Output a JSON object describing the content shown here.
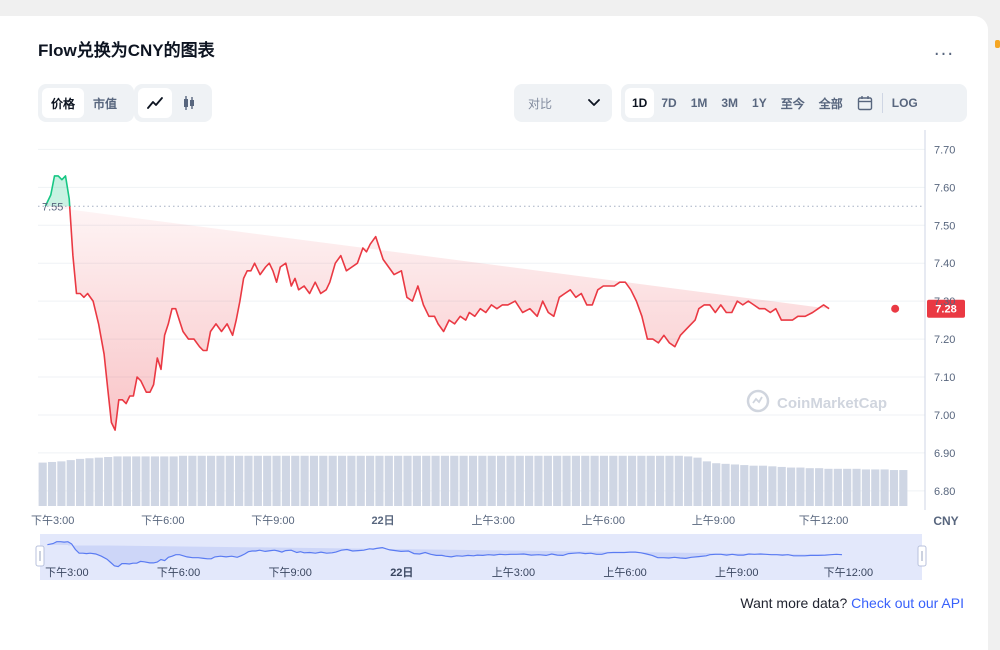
{
  "header": {
    "title": "Flow兑换为CNY的图表",
    "more_label": "..."
  },
  "type_toggle": [
    {
      "label": "价格",
      "active": true
    },
    {
      "label": "市值",
      "active": false
    }
  ],
  "style_toggle": [
    {
      "icon": "line-chart-icon",
      "active": true
    },
    {
      "icon": "candlestick-icon",
      "active": false
    }
  ],
  "compare": {
    "label": "对比",
    "icon": "chevron-down-icon"
  },
  "ranges": [
    {
      "label": "1D",
      "active": true
    },
    {
      "label": "7D",
      "active": false
    },
    {
      "label": "1M",
      "active": false
    },
    {
      "label": "3M",
      "active": false
    },
    {
      "label": "1Y",
      "active": false
    },
    {
      "label": "至今",
      "active": false
    },
    {
      "label": "全部",
      "active": false
    }
  ],
  "calendar_icon": "calendar-icon",
  "log_label": "LOG",
  "footer": {
    "text": "Want more data?",
    "link": "Check out our API"
  },
  "chart_data": {
    "type": "area",
    "currency_label": "CNY",
    "watermark": "CoinMarketCap",
    "open_price_label": "7.55",
    "open_price": 7.55,
    "last_price_label": "7.28",
    "last_price": 7.28,
    "ylim": [
      6.76,
      7.73
    ],
    "y_ticks": [
      "7.70",
      "7.60",
      "7.50",
      "7.40",
      "7.30",
      "7.20",
      "7.10",
      "7.00",
      "6.90",
      "6.80"
    ],
    "x_ticks": [
      "下午3:00",
      "下午6:00",
      "下午9:00",
      "22日",
      "上午3:00",
      "上午6:00",
      "上午9:00",
      "下午12:00"
    ],
    "x_tick_hours": [
      0,
      3,
      6,
      9,
      12,
      15,
      18,
      21
    ],
    "x_range_hours": [
      -0.4,
      23.3
    ],
    "up_color": "#16c784",
    "down_color": "#ea3943",
    "grid": true,
    "x": [
      -0.2,
      -0.05,
      0.05,
      0.15,
      0.25,
      0.35,
      0.45,
      0.55,
      0.65,
      0.75,
      0.85,
      0.95,
      1.1,
      1.25,
      1.4,
      1.5,
      1.6,
      1.7,
      1.8,
      1.9,
      2.0,
      2.1,
      2.2,
      2.3,
      2.4,
      2.55,
      2.65,
      2.75,
      2.85,
      2.95,
      3.05,
      3.15,
      3.25,
      3.35,
      3.45,
      3.55,
      3.7,
      3.85,
      4.0,
      4.1,
      4.2,
      4.3,
      4.45,
      4.6,
      4.75,
      4.9,
      5.0,
      5.1,
      5.2,
      5.3,
      5.4,
      5.5,
      5.65,
      5.8,
      5.9,
      6.0,
      6.1,
      6.2,
      6.35,
      6.5,
      6.6,
      6.7,
      6.85,
      7.0,
      7.15,
      7.3,
      7.45,
      7.55,
      7.7,
      7.85,
      8.0,
      8.15,
      8.3,
      8.45,
      8.55,
      8.65,
      8.8,
      8.9,
      9.0,
      9.15,
      9.3,
      9.5,
      9.65,
      9.8,
      9.95,
      10.1,
      10.25,
      10.4,
      10.5,
      10.65,
      10.8,
      10.95,
      11.1,
      11.25,
      11.35,
      11.5,
      11.65,
      11.8,
      11.95,
      12.1,
      12.25,
      12.4,
      12.6,
      12.8,
      13.0,
      13.2,
      13.35,
      13.5,
      13.65,
      13.8,
      13.95,
      14.1,
      14.25,
      14.4,
      14.55,
      14.7,
      14.85,
      15.0,
      15.15,
      15.3,
      15.45,
      15.6,
      15.75,
      15.9,
      16.05,
      16.2,
      16.35,
      16.5,
      16.65,
      16.8,
      16.95,
      17.1,
      17.3,
      17.5,
      17.6,
      17.75,
      17.9,
      18.05,
      18.2,
      18.35,
      18.5,
      18.65,
      18.8,
      18.95,
      19.1,
      19.25,
      19.4,
      19.55,
      19.7,
      19.85,
      20.0,
      20.15,
      20.3,
      20.5,
      20.7,
      20.85,
      21.0,
      21.15,
      21.3,
      21.5,
      21.7,
      21.85,
      22.0,
      22.2,
      22.35,
      22.5,
      22.7,
      22.95
    ],
    "y": [
      7.55,
      7.58,
      7.63,
      7.63,
      7.62,
      7.63,
      7.57,
      7.42,
      7.32,
      7.32,
      7.31,
      7.32,
      7.3,
      7.24,
      7.16,
      7.07,
      6.98,
      6.96,
      7.04,
      7.04,
      7.03,
      7.05,
      7.05,
      7.1,
      7.09,
      7.06,
      7.06,
      7.08,
      7.15,
      7.12,
      7.21,
      7.24,
      7.28,
      7.28,
      7.25,
      7.22,
      7.2,
      7.2,
      7.18,
      7.17,
      7.17,
      7.22,
      7.24,
      7.22,
      7.24,
      7.21,
      7.25,
      7.3,
      7.36,
      7.38,
      7.38,
      7.4,
      7.37,
      7.39,
      7.4,
      7.38,
      7.35,
      7.39,
      7.4,
      7.34,
      7.36,
      7.33,
      7.34,
      7.32,
      7.35,
      7.32,
      7.33,
      7.35,
      7.4,
      7.42,
      7.38,
      7.39,
      7.4,
      7.44,
      7.43,
      7.45,
      7.47,
      7.44,
      7.41,
      7.39,
      7.37,
      7.38,
      7.31,
      7.3,
      7.34,
      7.29,
      7.26,
      7.26,
      7.24,
      7.22,
      7.25,
      7.24,
      7.26,
      7.25,
      7.27,
      7.26,
      7.28,
      7.27,
      7.29,
      7.28,
      7.29,
      7.29,
      7.3,
      7.27,
      7.28,
      7.26,
      7.3,
      7.27,
      7.26,
      7.31,
      7.32,
      7.33,
      7.31,
      7.32,
      7.29,
      7.29,
      7.33,
      7.34,
      7.34,
      7.34,
      7.35,
      7.35,
      7.33,
      7.3,
      7.26,
      7.2,
      7.2,
      7.19,
      7.21,
      7.19,
      7.18,
      7.21,
      7.23,
      7.25,
      7.28,
      7.29,
      7.29,
      7.27,
      7.29,
      7.27,
      7.27,
      7.3,
      7.29,
      7.3,
      7.29,
      7.28,
      7.28,
      7.27,
      7.28,
      7.25,
      7.25,
      7.25,
      7.26,
      7.26,
      7.27,
      7.28,
      7.29,
      7.28
    ],
    "volume_relative": [
      0.7,
      0.71,
      0.72,
      0.74,
      0.76,
      0.77,
      0.78,
      0.79,
      0.8,
      0.8,
      0.8,
      0.8,
      0.8,
      0.8,
      0.8,
      0.81,
      0.81,
      0.81,
      0.81,
      0.81,
      0.81,
      0.81,
      0.81,
      0.81,
      0.81,
      0.81,
      0.81,
      0.81,
      0.81,
      0.81,
      0.81,
      0.81,
      0.81,
      0.81,
      0.81,
      0.81,
      0.81,
      0.81,
      0.81,
      0.81,
      0.81,
      0.81,
      0.81,
      0.81,
      0.81,
      0.81,
      0.81,
      0.81,
      0.81,
      0.81,
      0.81,
      0.81,
      0.81,
      0.81,
      0.81,
      0.81,
      0.81,
      0.81,
      0.81,
      0.81,
      0.81,
      0.81,
      0.81,
      0.81,
      0.81,
      0.81,
      0.81,
      0.81,
      0.81,
      0.8,
      0.78,
      0.72,
      0.69,
      0.68,
      0.67,
      0.66,
      0.65,
      0.65,
      0.64,
      0.63,
      0.62,
      0.62,
      0.61,
      0.61,
      0.6,
      0.6,
      0.6,
      0.6,
      0.59,
      0.59,
      0.59,
      0.58,
      0.58
    ]
  }
}
